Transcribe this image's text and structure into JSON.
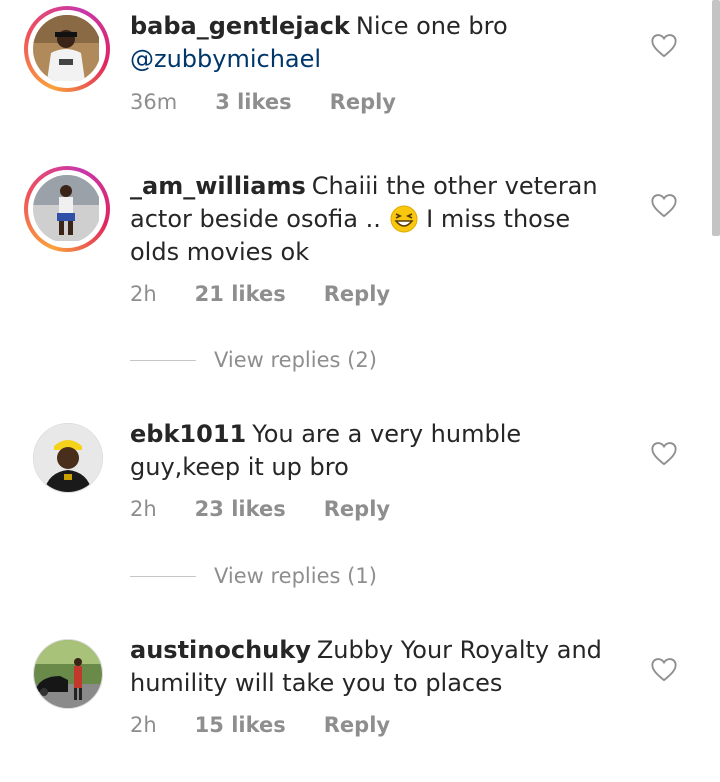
{
  "comments": [
    {
      "username": "baba_gentlejack",
      "text": "Nice one bro",
      "mention": "@zubbymichael",
      "time": "36m",
      "likes": "3 likes",
      "reply": "Reply",
      "has_story_ring": true
    },
    {
      "username": "_am_williams",
      "text_before_emoji": "Chaiii the other veteran actor beside osofia ..",
      "text_after_emoji": "I miss those olds movies ok",
      "emoji": "grinning-squinting-face",
      "time": "2h",
      "likes": "21 likes",
      "reply": "Reply",
      "view_replies": "View replies (2)",
      "has_story_ring": true
    },
    {
      "username": "ebk1011",
      "text": "You are a very humble guy,keep it up bro",
      "time": "2h",
      "likes": "23 likes",
      "reply": "Reply",
      "view_replies": "View replies (1)",
      "has_story_ring": false
    },
    {
      "username": "austinochuky",
      "text": "Zubby Your Royalty and humility will take you to places",
      "time": "2h",
      "likes": "15 likes",
      "reply": "Reply",
      "has_story_ring": false
    }
  ],
  "colors": {
    "text": "#262626",
    "secondary": "#8e8e8e",
    "mention": "#00376b",
    "divider": "#c7c7c7"
  },
  "icons": {
    "like": "heart-outline-icon"
  }
}
